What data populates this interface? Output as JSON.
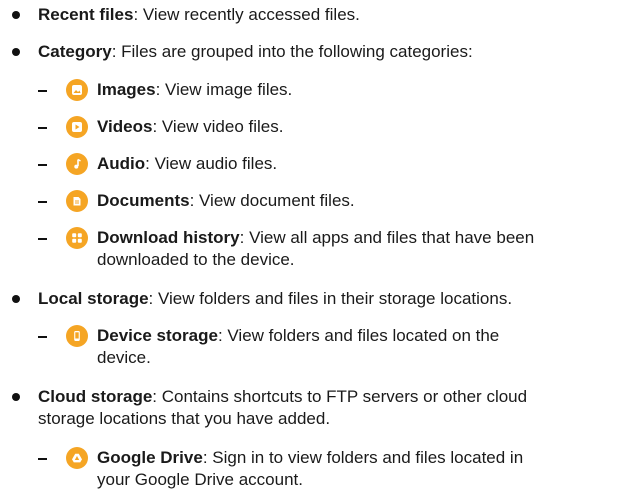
{
  "items": [
    {
      "title": "Recent files",
      "desc": ": View recently accessed files."
    },
    {
      "title": "Category",
      "desc": ": Files are grouped into the following categories:"
    },
    {
      "title": "Images",
      "desc": ": View image files.",
      "icon": "image-icon"
    },
    {
      "title": "Videos",
      "desc": ": View video files.",
      "icon": "video-icon"
    },
    {
      "title": "Audio",
      "desc": ": View audio files.",
      "icon": "music-note-icon"
    },
    {
      "title": "Documents",
      "desc": ": View document files.",
      "icon": "document-icon"
    },
    {
      "title": "Download history",
      "desc": ": View all apps and files that have been downloaded to the device.",
      "icon": "download-history-icon"
    },
    {
      "title": "Local storage",
      "desc": ": View folders and files in their storage locations."
    },
    {
      "title": "Device storage",
      "desc": ": View folders and files located on the device.",
      "icon": "phone-icon"
    },
    {
      "title": "Cloud storage",
      "desc": ": Contains shortcuts to FTP servers or other cloud storage locations that you have added."
    },
    {
      "title": "Google Drive",
      "desc": ": Sign in to view folders and files located in your Google Drive account.",
      "icon": "google-drive-icon"
    }
  ],
  "icon_color": "#f5a524"
}
